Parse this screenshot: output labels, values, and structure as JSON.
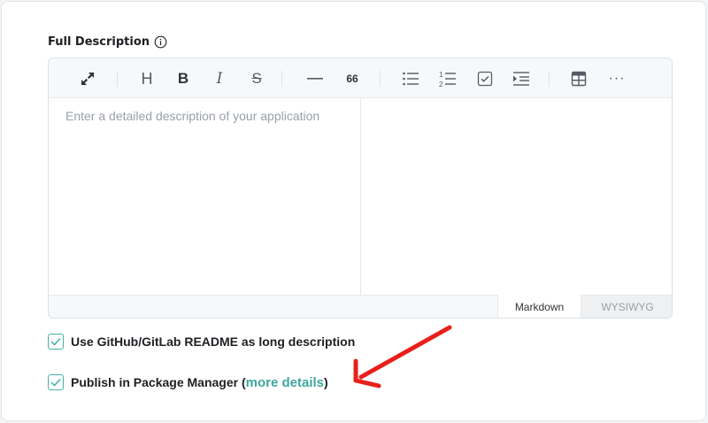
{
  "section": {
    "label": "Full Description",
    "info_icon": "info-circle-icon"
  },
  "editor": {
    "placeholder": "Enter a detailed description of your application",
    "toolbar": {
      "heading": "H",
      "bold": "B",
      "italic": "I",
      "strike": "S",
      "quote": "66",
      "more": "···"
    },
    "modes": {
      "markdown": "Markdown",
      "wysiwyg": "WYSIWYG"
    }
  },
  "options": {
    "readme_label": "Use GitHub/GitLab README as long description",
    "publish_prefix": "Publish in Package Manager (",
    "publish_link": "more details",
    "publish_suffix": ")"
  },
  "colors": {
    "accent": "#3fa79e",
    "arrow": "#e8201a"
  }
}
